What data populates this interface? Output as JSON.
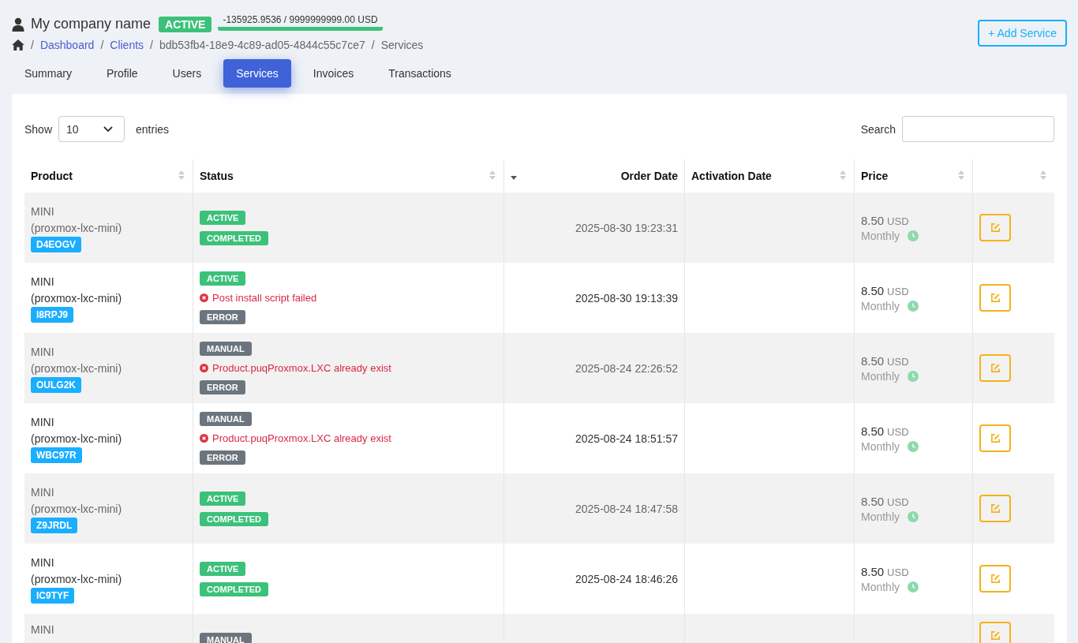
{
  "header": {
    "company": "My company name",
    "status_badge": "ACTIVE",
    "balance": "-135925.9536 / 9999999999.00 USD"
  },
  "breadcrumb": [
    {
      "separator": "/",
      "label": "Dashboard",
      "link": true
    },
    {
      "separator": "/",
      "label": "Clients",
      "link": true
    },
    {
      "separator": "/",
      "label": "bdb53fb4-18e9-4c89-ad05-4844c55c7ce7",
      "link": false
    },
    {
      "separator": "/",
      "label": "Services",
      "link": false
    }
  ],
  "add_button": "+ Add Service",
  "tabs": [
    {
      "label": "Summary",
      "selected": false
    },
    {
      "label": "Profile",
      "selected": false
    },
    {
      "label": "Users",
      "selected": false
    },
    {
      "label": "Services",
      "selected": true
    },
    {
      "label": "Invoices",
      "selected": false
    },
    {
      "label": "Transactions",
      "selected": false
    }
  ],
  "length_menu": {
    "show": "Show",
    "value": "10",
    "entries": "entries"
  },
  "search": {
    "label": "Search"
  },
  "table": {
    "columns": [
      {
        "label": "Product",
        "sorted_desc": false
      },
      {
        "label": "Status",
        "sorted_desc": false
      },
      {
        "label": "Order Date",
        "sorted_desc": true
      },
      {
        "label": "Activation Date",
        "sorted_desc": false
      },
      {
        "label": "Price",
        "sorted_desc": false
      },
      {
        "sorted_desc": false
      }
    ],
    "rows": [
      {
        "product": "MINI",
        "module": "(proxmox-lxc-mini)",
        "code": "D4EOGV",
        "status": [
          {
            "kind": "badge",
            "text": "ACTIVE",
            "color": "#3cc17a"
          },
          {
            "kind": "badge",
            "text": "COMPLETED",
            "color": "#3cc17a"
          }
        ],
        "order_date": "2025-08-30 19:23:31",
        "price": "8.50",
        "currency": "USD",
        "period": "Monthly"
      },
      {
        "product": "MINI",
        "module": "(proxmox-lxc-mini)",
        "code": "I8RPJ9",
        "status": [
          {
            "kind": "badge",
            "text": "ACTIVE",
            "color": "#3cc17a"
          },
          {
            "kind": "error",
            "text": "Post install script failed"
          },
          {
            "kind": "badge",
            "text": "ERROR",
            "color": "#6c757d"
          }
        ],
        "order_date": "2025-08-30 19:13:39",
        "price": "8.50",
        "currency": "USD",
        "period": "Monthly"
      },
      {
        "product": "MINI",
        "module": "(proxmox-lxc-mini)",
        "code": "OULG2K",
        "status": [
          {
            "kind": "badge",
            "text": "MANUAL",
            "color": "#6c757d"
          },
          {
            "kind": "error",
            "text": "Product.puqProxmox.LXC already exist"
          },
          {
            "kind": "badge",
            "text": "ERROR",
            "color": "#6c757d"
          }
        ],
        "order_date": "2025-08-24 22:26:52",
        "price": "8.50",
        "currency": "USD",
        "period": "Monthly"
      },
      {
        "product": "MINI",
        "module": "(proxmox-lxc-mini)",
        "code": "WBC97R",
        "status": [
          {
            "kind": "badge",
            "text": "MANUAL",
            "color": "#6c757d"
          },
          {
            "kind": "error",
            "text": "Product.puqProxmox.LXC already exist"
          },
          {
            "kind": "badge",
            "text": "ERROR",
            "color": "#6c757d"
          }
        ],
        "order_date": "2025-08-24 18:51:57",
        "price": "8.50",
        "currency": "USD",
        "period": "Monthly"
      },
      {
        "product": "MINI",
        "module": "(proxmox-lxc-mini)",
        "code": "Z9JRDL",
        "status": [
          {
            "kind": "badge",
            "text": "ACTIVE",
            "color": "#3cc17a"
          },
          {
            "kind": "badge",
            "text": "COMPLETED",
            "color": "#3cc17a"
          }
        ],
        "order_date": "2025-08-24 18:47:58",
        "price": "8.50",
        "currency": "USD",
        "period": "Monthly"
      },
      {
        "product": "MINI",
        "module": "(proxmox-lxc-mini)",
        "code": "IC9TYF",
        "status": [
          {
            "kind": "badge",
            "text": "ACTIVE",
            "color": "#3cc17a"
          },
          {
            "kind": "badge",
            "text": "COMPLETED",
            "color": "#3cc17a"
          }
        ],
        "order_date": "2025-08-24 18:46:26",
        "price": "8.50",
        "currency": "USD",
        "period": "Monthly"
      },
      {
        "product": "MINI",
        "status": [
          {
            "kind": "badge",
            "text": "MANUAL",
            "color": "#6c757d"
          }
        ]
      }
    ]
  }
}
